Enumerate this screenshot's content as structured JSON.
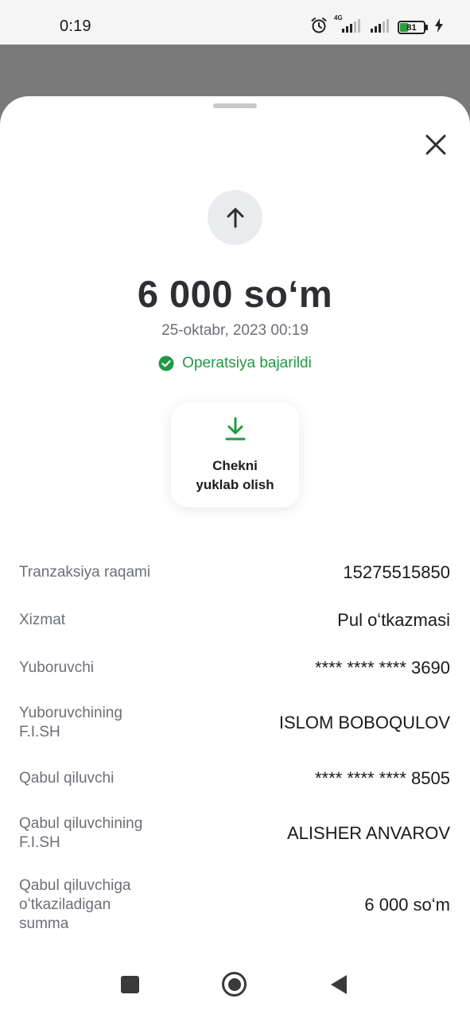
{
  "status_bar": {
    "time": "0:19",
    "network_label": "4G",
    "battery_level": "81"
  },
  "sheet": {
    "amount": "6 000 soʻm",
    "date": "25-oktabr, 2023 00:19",
    "status": "Operatsiya bajarildi",
    "download_label_line1": "Chekni",
    "download_label_line2": "yuklab olish",
    "details": [
      {
        "label": "Tranzaksiya raqami",
        "value": "15275515850"
      },
      {
        "label": "Xizmat",
        "value": "Pul oʻtkazmasi"
      },
      {
        "label": "Yuboruvchi",
        "value": "**** **** **** 3690"
      },
      {
        "label": "Yuboruvchining F.I.SH",
        "value": "ISLOM BOBOQULOV"
      },
      {
        "label": "Qabul qiluvchi",
        "value": "**** **** **** 8505"
      },
      {
        "label": "Qabul qiluvchining F.I.SH",
        "value": "ALISHER ANVAROV"
      },
      {
        "label": "Qabul qiluvchiga oʻtkaziladigan summa",
        "value": "6 000 soʻm"
      }
    ]
  },
  "colors": {
    "success": "#1f9a45",
    "text_primary": "#2d2f33",
    "text_secondary": "#6c6f75"
  },
  "icons": [
    "alarm-icon",
    "signal-icon",
    "battery-icon",
    "charging-icon",
    "close-icon",
    "arrow-up-icon",
    "check-circle-icon",
    "download-icon",
    "nav-recents-icon",
    "nav-home-icon",
    "nav-back-icon"
  ]
}
